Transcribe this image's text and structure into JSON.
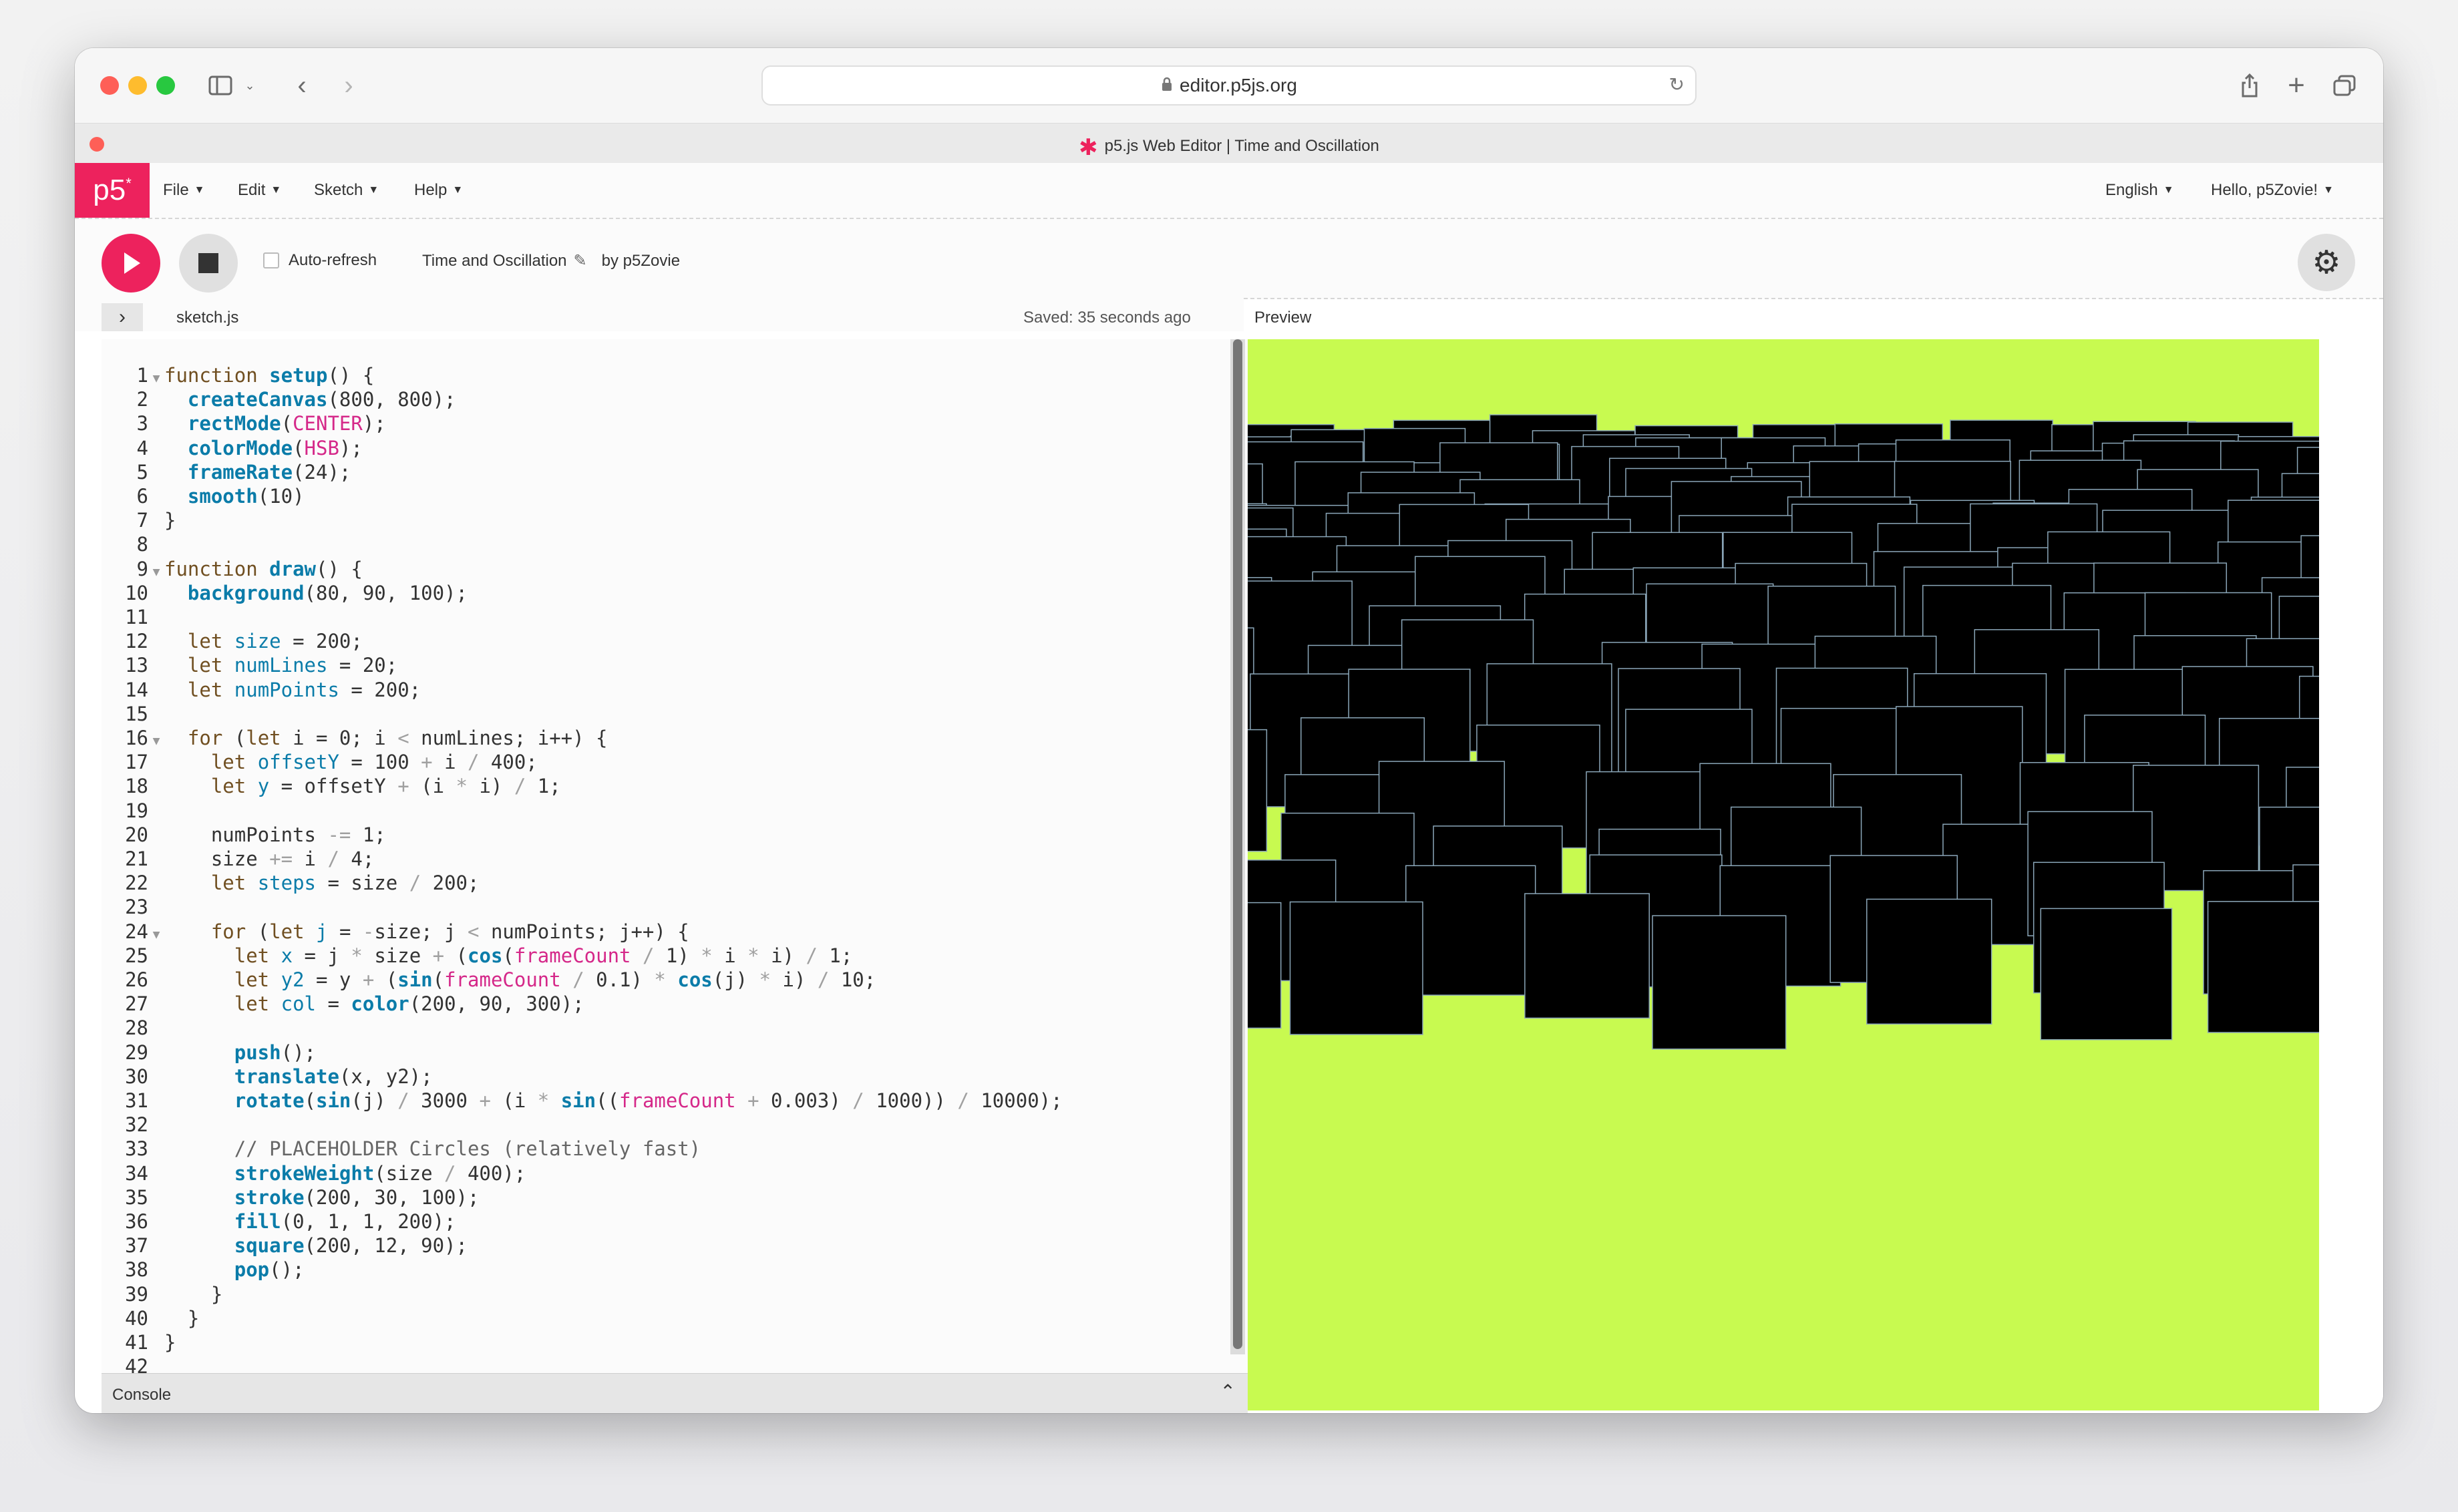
{
  "browser": {
    "url": "editor.p5js.org",
    "tab_title": "p5.js Web Editor | Time and Oscillation"
  },
  "nav": {
    "logo": "p5",
    "logo_sup": "*",
    "menus": [
      "File",
      "Edit",
      "Sketch",
      "Help"
    ],
    "language": "English",
    "user_greeting": "Hello, p5Zovie!"
  },
  "toolbar": {
    "auto_refresh_label": "Auto-refresh",
    "sketch_title": "Time and Oscillation",
    "author": "by p5Zovie"
  },
  "editor": {
    "file_name": "sketch.js",
    "saved_status": "Saved: 35 seconds ago",
    "console_label": "Console",
    "code_lines": [
      "function setup() {",
      "  createCanvas(800, 800);",
      "  rectMode(CENTER);",
      "  colorMode(HSB);",
      "  frameRate(24);",
      "  smooth(10)",
      "}",
      "",
      "function draw() {",
      "  background(80, 90, 100);",
      "",
      "  let size = 200;",
      "  let numLines = 20;",
      "  let numPoints = 200;",
      "",
      "  for (let i = 0; i < numLines; i++) {",
      "    let offsetY = 100 + i / 400;",
      "    let y = offsetY + (i * i) / 1;",
      "",
      "    numPoints -= 1;",
      "    size += i / 4;",
      "    let steps = size / 200;",
      "",
      "    for (let j = -size; j < numPoints; j++) {",
      "      let x = j * size + (cos(frameCount / 1) * i * i) / 1;",
      "      let y2 = y + (sin(frameCount / 0.1) * cos(j) * i) / 10;",
      "      let col = color(200, 90, 300);",
      "",
      "      push();",
      "      translate(x, y2);",
      "      rotate(sin(j) / 3000 + (i * sin((frameCount + 0.003) / 1000)) / 10000);",
      "",
      "      // PLACEHOLDER Circles (relatively fast)",
      "      strokeWeight(size / 400);",
      "      stroke(200, 30, 100);",
      "      fill(0, 1, 1, 200);",
      "      square(200, 12, 90);",
      "      pop();",
      "    }",
      "  }",
      "}",
      ""
    ],
    "fold_lines": [
      1,
      9,
      16,
      24
    ]
  },
  "preview": {
    "label": "Preview",
    "background_color": "#c8fa50",
    "square_color": "#000000",
    "square_stroke": "#8aa6b8"
  }
}
